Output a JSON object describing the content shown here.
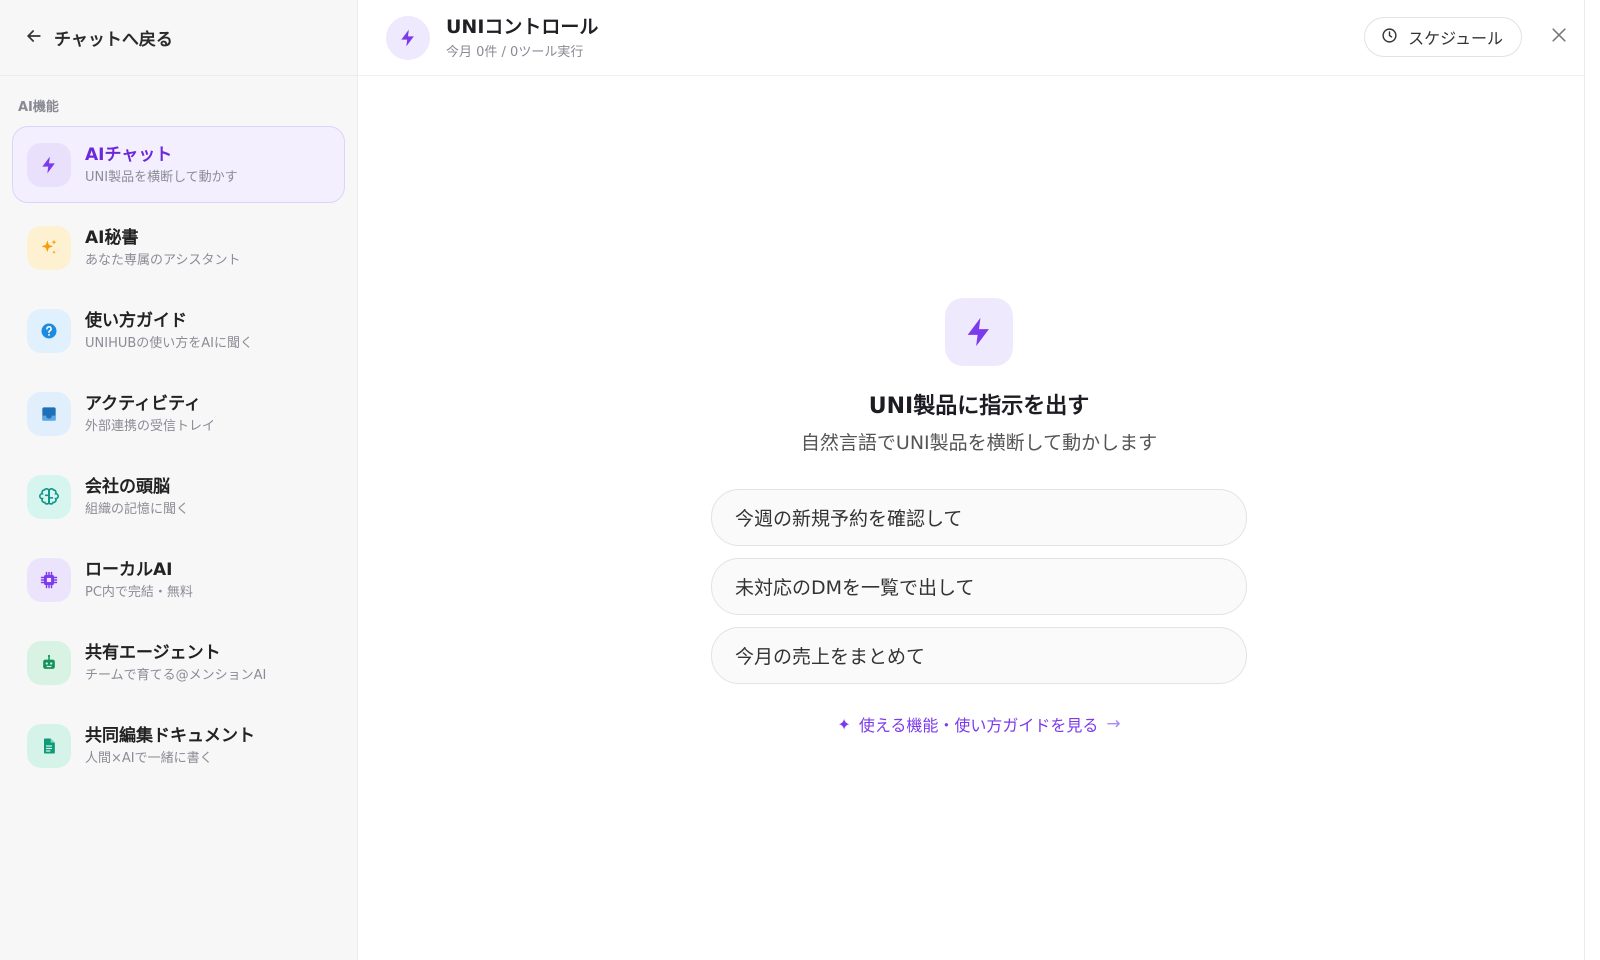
{
  "sidebar": {
    "back_label": "チャットへ戻る",
    "section_label": "AI機能",
    "items": [
      {
        "title": "AIチャット",
        "subtitle": "UNI製品を横断して動かす",
        "icon": "bolt-icon",
        "active": true
      },
      {
        "title": "AI秘書",
        "subtitle": "あなた専属のアシスタント",
        "icon": "sparkle-icon"
      },
      {
        "title": "使い方ガイド",
        "subtitle": "UNIHUBの使い方をAIに聞く",
        "icon": "help-circle-icon"
      },
      {
        "title": "アクティビティ",
        "subtitle": "外部連携の受信トレイ",
        "icon": "inbox-icon"
      },
      {
        "title": "会社の頭脳",
        "subtitle": "組織の記憶に聞く",
        "icon": "brain-icon"
      },
      {
        "title": "ローカルAI",
        "subtitle": "PC内で完結・無料",
        "icon": "chip-icon"
      },
      {
        "title": "共有エージェント",
        "subtitle": "チームで育てる@メンションAI",
        "icon": "robot-icon"
      },
      {
        "title": "共同編集ドキュメント",
        "subtitle": "人間×AIで一緒に書く",
        "icon": "document-icon"
      }
    ]
  },
  "header": {
    "title": "UNIコントロール",
    "subtitle": "今月 0件 / 0ツール実行",
    "schedule_label": "スケジュール"
  },
  "main": {
    "title": "UNI製品に指示を出す",
    "subtitle": "自然言語でUNI製品を横断して動かします",
    "suggestions": [
      "今週の新規予約を確認して",
      "未対応のDMを一覧で出して",
      "今月の売上をまとめて"
    ],
    "guide_link": "使える機能・使い方ガイドを見る",
    "guide_star": "✦",
    "guide_arrow": "→"
  },
  "colors": {
    "accent": "#7c3aed",
    "accent_bg": "#efe9fd"
  }
}
